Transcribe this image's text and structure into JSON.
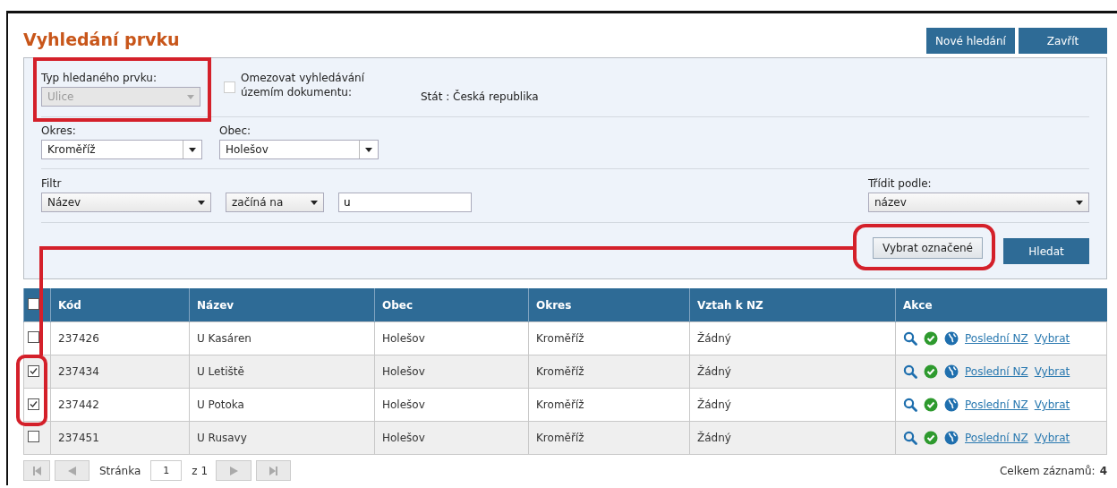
{
  "title": "Vyhledání prvku",
  "header_buttons": [
    "Nové hledání",
    "Zavřít"
  ],
  "search": {
    "type_field": {
      "label": "Typ hledaného prvku:",
      "value": "Ulice",
      "disabled": true
    },
    "restrict": {
      "label": "Omezovat vyhledávání územím dokumentu:",
      "checked": false
    },
    "scope": "Stát : Česká republika",
    "okres": {
      "label": "Okres:",
      "value": "Kroměříž"
    },
    "obec": {
      "label": "Obec:",
      "value": "Holešov"
    },
    "filter": {
      "label": "Filtr",
      "field": "Název",
      "operator": "začíná na",
      "value": "u"
    },
    "sort": {
      "label": "Třídit podle:",
      "value": "název"
    },
    "select_button": "Vybrat označené",
    "search_button": "Hledat"
  },
  "table": {
    "all_checked": false,
    "columns": [
      "Kód",
      "Název",
      "Obec",
      "Okres",
      "Vztah k NZ",
      "Akce"
    ],
    "rows": [
      {
        "checked": false,
        "cells": [
          "237426",
          "U Kasáren",
          "Holešov",
          "Kroměříž",
          "Žádný"
        ],
        "links": [
          "Poslední NZ",
          "Vybrat"
        ]
      },
      {
        "checked": true,
        "cells": [
          "237434",
          "U Letiště",
          "Holešov",
          "Kroměříž",
          "Žádný"
        ],
        "links": [
          "Poslední NZ",
          "Vybrat"
        ]
      },
      {
        "checked": true,
        "cells": [
          "237442",
          "U Potoka",
          "Holešov",
          "Kroměříž",
          "Žádný"
        ],
        "links": [
          "Poslední NZ",
          "Vybrat"
        ]
      },
      {
        "checked": false,
        "cells": [
          "237451",
          "U Rusavy",
          "Holešov",
          "Kroměříž",
          "Žádný"
        ],
        "links": [
          "Poslední NZ",
          "Vybrat"
        ]
      }
    ]
  },
  "pager": {
    "page_label": "Stránka",
    "page": "1",
    "of": "z 1",
    "total_label": "Celkem záznamů:",
    "total": "4"
  }
}
